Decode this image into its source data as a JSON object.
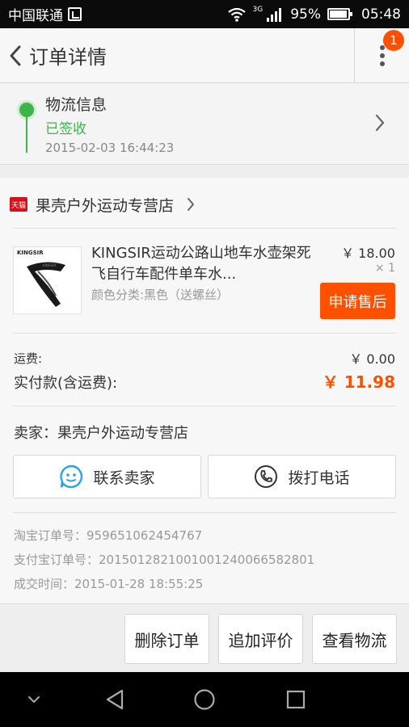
{
  "status_bar": {
    "carrier": "中国联通",
    "network": "3G",
    "battery": "95%",
    "time": "05:48"
  },
  "header": {
    "title": "订单详情",
    "badge": "1"
  },
  "logistics": {
    "title": "物流信息",
    "status": "已签收",
    "time": "2015-02-03 16:44:23"
  },
  "shop": {
    "tag": "天猫",
    "name": "果壳户外运动专营店"
  },
  "item": {
    "brand": "KINGSIR",
    "title": "KINGSIR运动公路山地车水壶架死飞自行车配件单车水...",
    "sku": "颜色分类:黑色（送螺丝）",
    "price": "￥ 18.00",
    "qty": "× 1",
    "after_sale_label": "申请售后"
  },
  "fees": {
    "shipping_label": "运费:",
    "shipping_value": "￥ 0.00",
    "paid_label": "实付款(含运费):",
    "paid_value": "￥ 11.98"
  },
  "seller": {
    "text": "卖家：果壳户外运动专营店",
    "contact_label": "联系卖家",
    "call_label": "拨打电话"
  },
  "order_meta": {
    "taobao_no": "淘宝订单号：959651062454767",
    "alipay_no": "支付宝订单号：2015012821001001240066582801",
    "deal_time": "成交时间：2015-01-28 18:55:25"
  },
  "actions": {
    "delete": "删除订单",
    "review": "追加评价",
    "logistics": "查看物流"
  },
  "colors": {
    "accent": "#ff5000",
    "green": "#3db54a",
    "tmall_red": "#d4121b",
    "contact_blue": "#27a3e6"
  }
}
